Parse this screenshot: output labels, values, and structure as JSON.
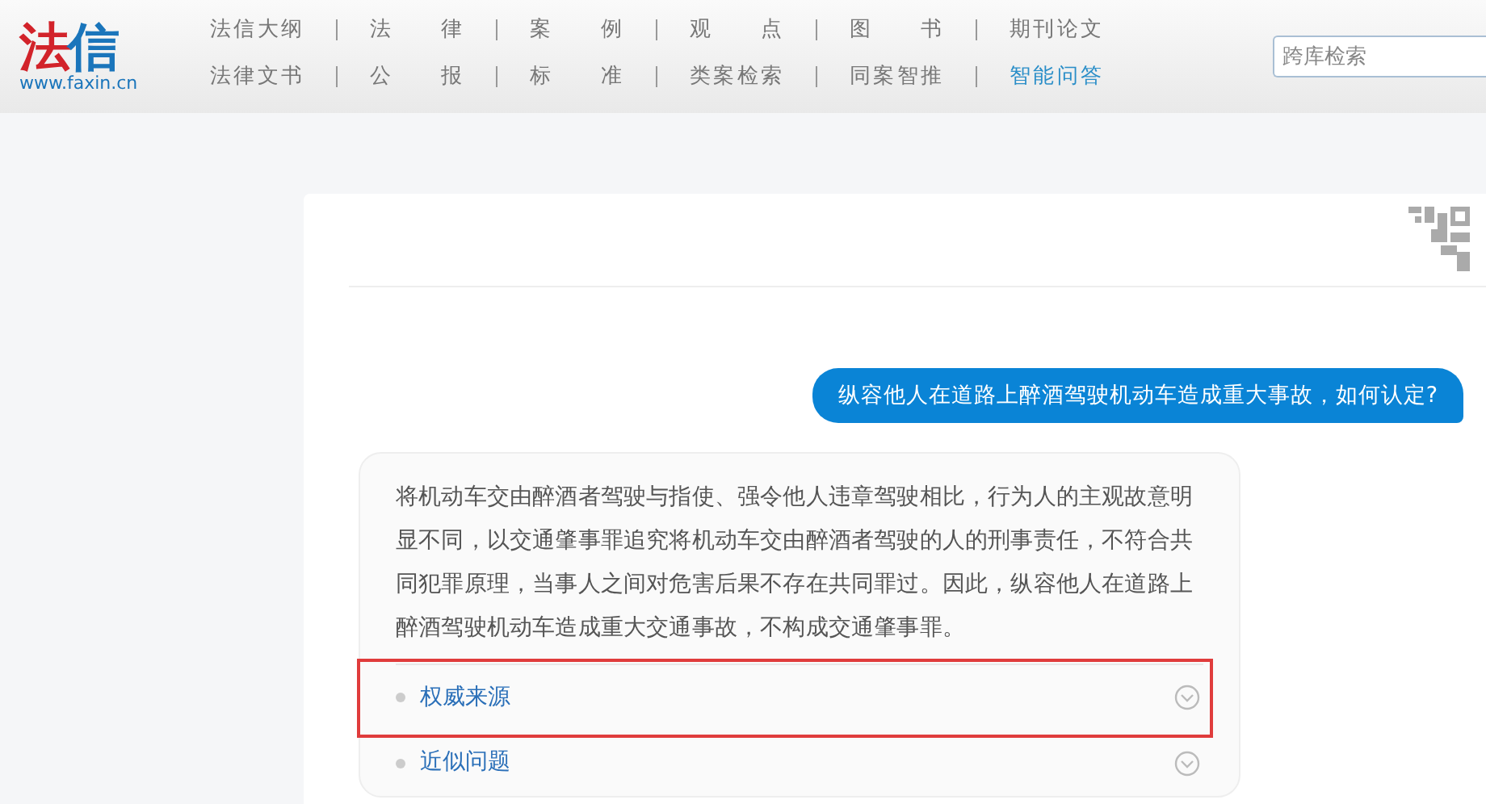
{
  "logo": {
    "name": "法信",
    "url": "www.faxin.cn"
  },
  "nav_rows": [
    [
      {
        "label": "法信大纲",
        "selected": false
      },
      {
        "label": "法律",
        "selected": false
      },
      {
        "label": "案例",
        "selected": false
      },
      {
        "label": "观点",
        "selected": false
      },
      {
        "label": "图书",
        "selected": false
      },
      {
        "label": "期刊论文",
        "selected": false
      }
    ],
    [
      {
        "label": "法律文书",
        "selected": false
      },
      {
        "label": "公报",
        "selected": false
      },
      {
        "label": "标准",
        "selected": false
      },
      {
        "label": "类案检索",
        "selected": false
      },
      {
        "label": "同案智推",
        "selected": false
      },
      {
        "label": "智能问答",
        "selected": true
      }
    ]
  ],
  "search": {
    "placeholder": "跨库检索"
  },
  "chat": {
    "question": "纵容他人在道路上醉酒驾驶机动车造成重大事故，如何认定?",
    "answer": "将机动车交由醉酒者驾驶与指使、强令他人违章驾驶相比，行为人的主观故意明显不同，以交通肇事罪追究将机动车交由醉酒者驾驶的人的刑事责任，不符合共同犯罪原理，当事人之间对危害后果不存在共同罪过。因此，纵容他人在道路上醉酒驾驶机动车造成重大交通事故，不构成交通肇事罪。",
    "sections": [
      {
        "label": "权威来源",
        "expanded": false,
        "highlighted": true
      },
      {
        "label": "近似问题",
        "expanded": false,
        "highlighted": false
      }
    ]
  }
}
